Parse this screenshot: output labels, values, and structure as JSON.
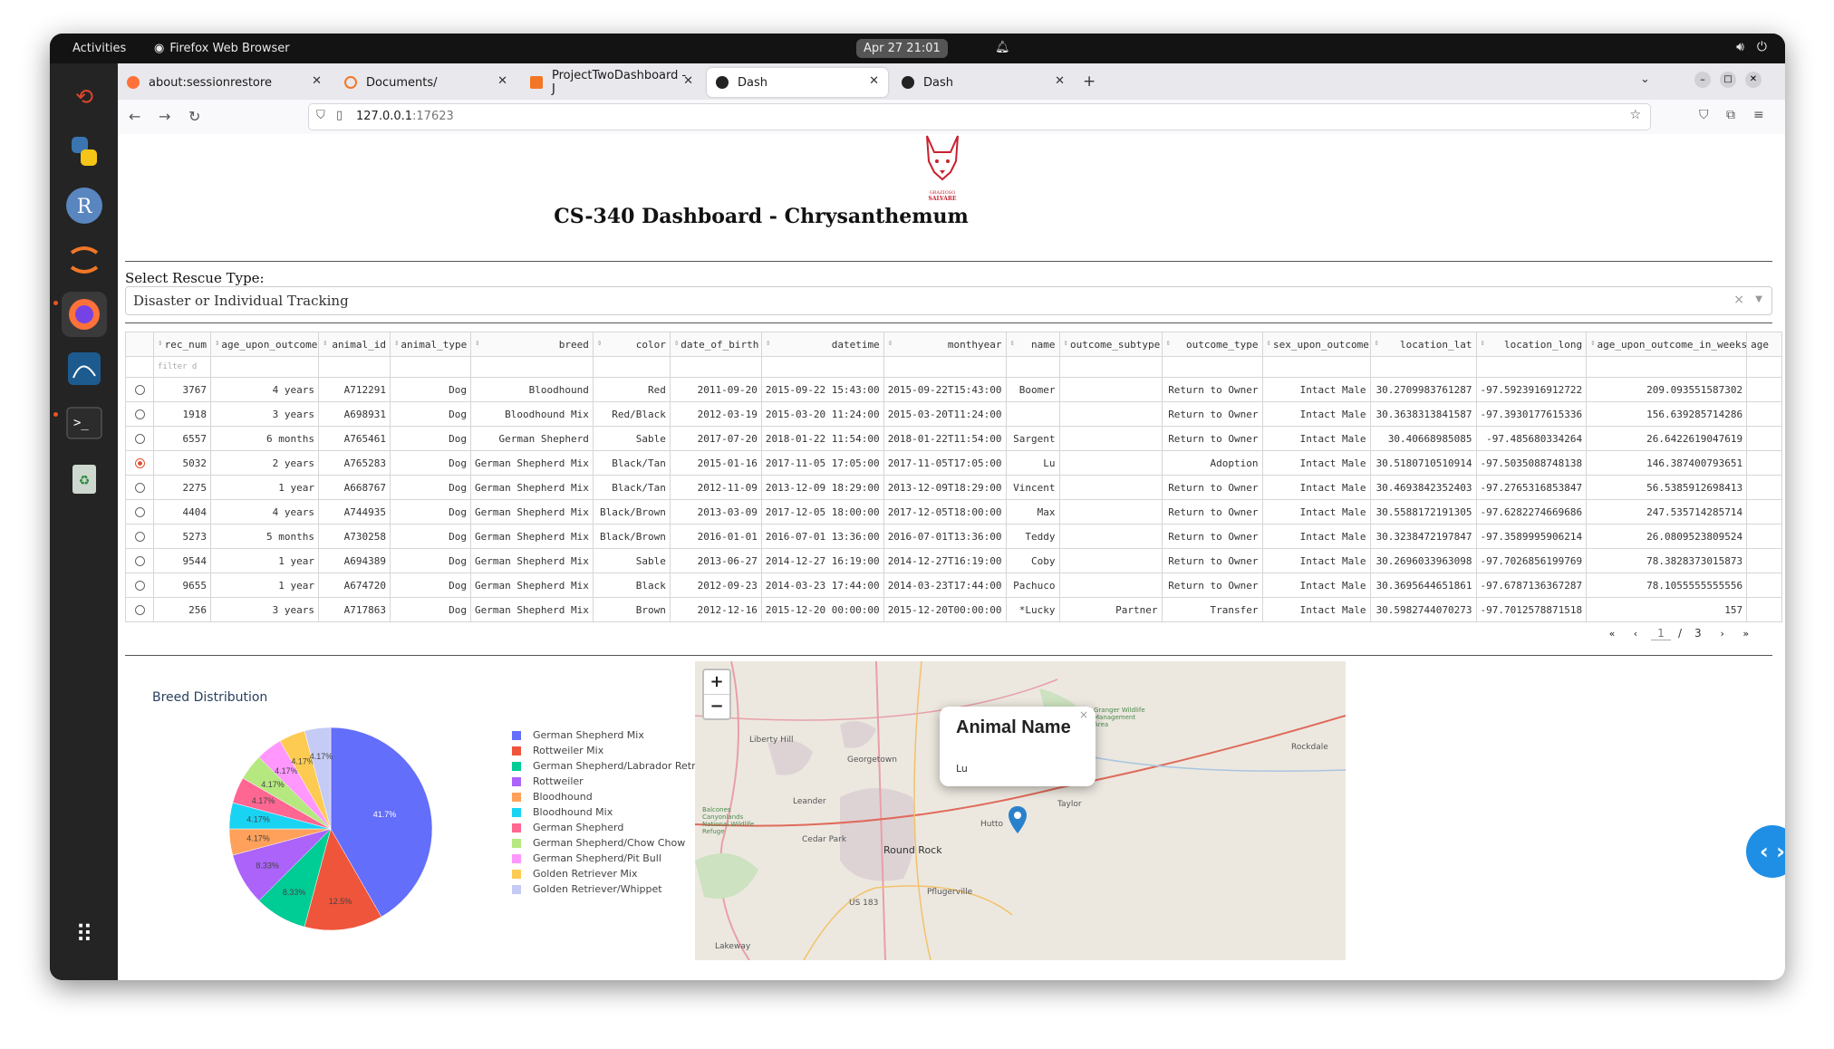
{
  "os": {
    "activities": "Activities",
    "app_name": "Firefox Web Browser",
    "clock": "Apr 27  21:01"
  },
  "browser": {
    "tabs": [
      {
        "label": "about:sessionrestore"
      },
      {
        "label": "Documents/"
      },
      {
        "label": "ProjectTwoDashboard - J"
      },
      {
        "label": "Dash"
      },
      {
        "label": "Dash"
      }
    ],
    "url_host": "127.0.0.1",
    "url_port": ":17623"
  },
  "page": {
    "logo_text": "GRAZIOSO SALVARE",
    "title": "CS-340 Dashboard - Chrysanthemum",
    "select_label": "Select Rescue Type:",
    "select_value": "Disaster or Individual Tracking",
    "select_clear": "×"
  },
  "table": {
    "columns": [
      "rec_num",
      "age_upon_outcome",
      "animal_id",
      "animal_type",
      "breed",
      "color",
      "date_of_birth",
      "datetime",
      "monthyear",
      "name",
      "outcome_subtype",
      "outcome_type",
      "sex_upon_outcome",
      "location_lat",
      "location_long",
      "age_upon_outcome_in_weeks",
      "age"
    ],
    "filter_placeholder": "filter d",
    "selected_row": 3,
    "rows": [
      [
        "3767",
        "4 years",
        "A712291",
        "Dog",
        "Bloodhound",
        "Red",
        "2011-09-20",
        "2015-09-22 15:43:00",
        "2015-09-22T15:43:00",
        "Boomer",
        "",
        "Return to Owner",
        "Intact Male",
        "30.2709983761287",
        "-97.5923916912722",
        "209.093551587302",
        ""
      ],
      [
        "1918",
        "3 years",
        "A698931",
        "Dog",
        "Bloodhound Mix",
        "Red/Black",
        "2012-03-19",
        "2015-03-20 11:24:00",
        "2015-03-20T11:24:00",
        "",
        "",
        "Return to Owner",
        "Intact Male",
        "30.3638313841587",
        "-97.3930177615336",
        "156.639285714286",
        ""
      ],
      [
        "6557",
        "6 months",
        "A765461",
        "Dog",
        "German Shepherd",
        "Sable",
        "2017-07-20",
        "2018-01-22 11:54:00",
        "2018-01-22T11:54:00",
        "Sargent",
        "",
        "Return to Owner",
        "Intact Male",
        "30.40668985085",
        "-97.485680334264",
        "26.6422619047619",
        ""
      ],
      [
        "5032",
        "2 years",
        "A765283",
        "Dog",
        "German Shepherd Mix",
        "Black/Tan",
        "2015-01-16",
        "2017-11-05 17:05:00",
        "2017-11-05T17:05:00",
        "Lu",
        "",
        "Adoption",
        "Intact Male",
        "30.5180710510914",
        "-97.5035088748138",
        "146.387400793651",
        ""
      ],
      [
        "2275",
        "1 year",
        "A668767",
        "Dog",
        "German Shepherd Mix",
        "Black/Tan",
        "2012-11-09",
        "2013-12-09 18:29:00",
        "2013-12-09T18:29:00",
        "Vincent",
        "",
        "Return to Owner",
        "Intact Male",
        "30.4693842352403",
        "-97.2765316853847",
        "56.5385912698413",
        ""
      ],
      [
        "4404",
        "4 years",
        "A744935",
        "Dog",
        "German Shepherd Mix",
        "Black/Brown",
        "2013-03-09",
        "2017-12-05 18:00:00",
        "2017-12-05T18:00:00",
        "Max",
        "",
        "Return to Owner",
        "Intact Male",
        "30.5588172191305",
        "-97.6282274669686",
        "247.535714285714",
        ""
      ],
      [
        "5273",
        "5 months",
        "A730258",
        "Dog",
        "German Shepherd Mix",
        "Black/Brown",
        "2016-01-01",
        "2016-07-01 13:36:00",
        "2016-07-01T13:36:00",
        "Teddy",
        "",
        "Return to Owner",
        "Intact Male",
        "30.3238472197847",
        "-97.3589995906214",
        "26.0809523809524",
        ""
      ],
      [
        "9544",
        "1 year",
        "A694389",
        "Dog",
        "German Shepherd Mix",
        "Sable",
        "2013-06-27",
        "2014-12-27 16:19:00",
        "2014-12-27T16:19:00",
        "Coby",
        "",
        "Return to Owner",
        "Intact Male",
        "30.2696033963098",
        "-97.7026856199769",
        "78.3828373015873",
        ""
      ],
      [
        "9655",
        "1 year",
        "A674720",
        "Dog",
        "German Shepherd Mix",
        "Black",
        "2012-09-23",
        "2014-03-23 17:44:00",
        "2014-03-23T17:44:00",
        "Pachuco",
        "",
        "Return to Owner",
        "Intact Male",
        "30.3695644651861",
        "-97.6787136367287",
        "78.1055555555556",
        ""
      ],
      [
        "256",
        "3 years",
        "A717863",
        "Dog",
        "German Shepherd Mix",
        "Brown",
        "2012-12-16",
        "2015-12-20 00:00:00",
        "2015-12-20T00:00:00",
        "*Lucky",
        "Partner",
        "Transfer",
        "Intact Male",
        "30.5982744070273",
        "-97.7012578871518",
        "157",
        ""
      ]
    ]
  },
  "pager": {
    "current": "1",
    "separator": "/",
    "total": "3"
  },
  "chart_data": {
    "type": "pie",
    "title": "Breed Distribution",
    "labels": [
      "German Shepherd Mix",
      "Rottweiler Mix",
      "German Shepherd/Labrador Retriever",
      "Rottweiler",
      "Bloodhound",
      "Bloodhound Mix",
      "German Shepherd",
      "German Shepherd/Chow Chow",
      "German Shepherd/Pit Bull",
      "Golden Retriever Mix",
      "Golden Retriever/Whippet"
    ],
    "values": [
      41.7,
      12.5,
      8.33,
      8.33,
      4.17,
      4.17,
      4.17,
      4.17,
      4.17,
      4.17,
      4.17
    ],
    "value_labels": [
      "41.7%",
      "12.5%",
      "8.33%",
      "8.33%",
      "4.17%",
      "4.17%",
      "4.17%",
      "4.17%",
      "4.17%",
      "4.17%",
      "4.17%"
    ],
    "colors": [
      "#636efa",
      "#ef553b",
      "#00cc96",
      "#ab63fa",
      "#ffa15a",
      "#19d3f3",
      "#ff6692",
      "#b6e880",
      "#ff97ff",
      "#fecb52",
      "#c5cbf5"
    ],
    "legend_position": "right"
  },
  "map": {
    "zoom_in": "+",
    "zoom_out": "−",
    "popup_title": "Animal Name",
    "popup_body": "Lu",
    "popup_close": "×",
    "places": [
      "Liberty Hill",
      "Georgetown",
      "Leander",
      "Cedar Park",
      "Round Rock",
      "Hutto",
      "Pflugerville",
      "Rockdale",
      "Lakeway",
      "US 183",
      "Taylor",
      "Granger Wildlife Management Area",
      "Balcones Canyonlands National Wildlife Refuge"
    ]
  }
}
